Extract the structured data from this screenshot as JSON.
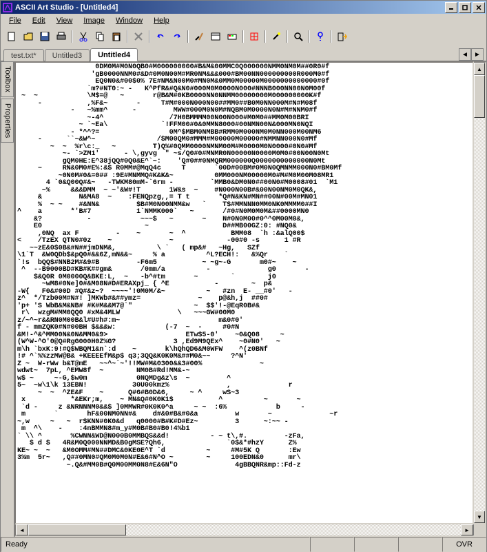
{
  "titlebar": {
    "text": "ASCII Art Studio - [Untitled4]"
  },
  "menu": {
    "file": "File",
    "edit": "Edit",
    "view": "View",
    "image": "Image",
    "window": "Window",
    "help": "Help"
  },
  "tabs": {
    "t1": "test.txt*",
    "t2": "Untitled3",
    "t3": "Untitled4"
  },
  "side": {
    "toolbox": "Toolbox",
    "properties": "Properties"
  },
  "status": {
    "ready": "Ready",
    "ovr": "OVR"
  },
  "ascii_art": "                   0DM0M#M0N0QB0#M000000000#B&M&00MMC0Q000000NMM0NM0M##0R0#f\n                  'gB0000NNM0#&D#0M0N00M#MR0NM&&&000#BM00NN000000000R000M0#f\n                   EQ0N0&#00$0% 7E#NM&N00M0#MN0M&0MM0M00000M0000000000000#0f\n                 `m?#NT0:~ -   K^PfR&#Q&N0#000M0M0000N000#NNNB000NN00N0M00f\n ~  ~            \\M$=@   ~       r@B&M#0KB0000NN0NNMM00000000M000000000K#f\n     -           ,%F&~       -     T#M#000N000N00##MM0##B0M0NN000M#N#M08f\n             -   ~%mm^      -         MWW#000M0N0M#NQBM0M0000N0N#M#NNM0#f\n                 ~-4^                /7H0BMMMM00N00N000#M0M0##MM0M00BRI\n               ~ `~Ea\\             `!FFM00#0&0MMN8000#00NMN00N&000MN0NQI\n             - *^^?=                 0M^$MBM0NMBB#RMM0M000NM0M0NN000M00NM6\n     -      ``~&W^~               /$M00QM0#MMM#M00000M00000#NMMNN000N0#Mf\n        ~  ~  %r\\c:_   ~         T)Q%#0QMM0000NMNM00M#M0000M0N0000#0N0#Mf\n           ~- `>ZM1'      - \\,gyvg  \" ~s/Q0#0#MNMR0N00000N0000M0M0#00N00N0Mt\n           gQM0HE:E^38jQQ#0Q0&E^`~:    'Q#0##0NMQRM000000Q0000000000000N0Mt\n     ~     RN&0M0#E%:&$ R0MM#@MqQ4c     T       `00D#00BM#0M0N0QMNMM000N0#BM0Mf\n          ~0N0M#0&=0## :9E#MNMMQ#K&K&~          0MM000NM00000M0#M#M0M00M08MR1\n       4 `0&Q00Q#&~   -TWKM80mM-`6rm -         `MMB0&DM0N0##00N0#M0008#01  `M1\n      ~%     &&&DMM  ~ ~'&W#!T       1W&s  ~    #N000N00B#&00N00NM0M0QK&,\n     &         N&MA8  ~    :FENQpzg,,= T t       *Q#N&KN#MN##00N#00M#MN01\n     %  ~ ~    #&NN&         $B#M0N00NMM&w   `    T$#MMNNN0MM0NK0MMMM0##I\n^    a       *'B#7           1`NMMK000`   ~       /#0#N0M0M0M&##0000MN0\n    &?           -            ~~~$   ~       ~    N#0N0M00#0^^0M00M0&,\n    E0                         ~                  D##MB00GZ:0: #NQ0&\n     ,0NQ  ax F         -    ~       ~  ^           BMM08  `h :&alQ00$\n<    /TzEX QTN0#0z    ~              ~             -00#0 -s      1 #R\n   ~~zE&0$0B&#N##jmDNM&,          \\ `   ( mp&#   ~Hg,   SZf\n\\1`T  &W0QDb$&pQ0#&&6Z,mN&&~     % a          ^L?ECH!:   &%Qr    `\n`!s  bQQ$#NNB2M#&9#B         -F6m5           ~ ~g~-G       m0#~    ~\n ^  --B9000BD#KB#K##gm&       /0mm/a          -              g0       -\n    $&Q0R 0M0000Q&BKE:L,  ~   -b^#tm       ~        `        j0\n      ~wM8#0Ne]0#&M08N#D#ERAXpj_ { ^E           -        ~  p&\n-W{   F0&#00D #Q#&z~?  ~~~~'!0M0M/&~          ~   #zn  E- __#0'   -\nz^  */Tzb00M#N#! ]MKWb#&##ymz=              ~    p@&h,j  ##0#\n'p+ 'S WbB&M&NB# #K#M&&M7@`\"               ~  $$'!-@EqR0B#&\n r\\  wzgM#MM0QQ0 #xM&4MLW              \\   ~~~GW#00M0\nz/~^~r&&RN0M00B&l#U#h#:m~                        m&0#0'\nf - mmZQK0#N#00BH $&&&w:            (-7  ~  -     #0#N\n&M!-^&^MM00N&0N&MM0&9>                   ETw$5-0'    ~0&Q08     ~\n(W^W-^O'0@Q#RgG000H0Z%G?              3 ,Ed9M9QEx^    ~0#N0'   ~\nm\\h `bxK:9!#Q$WBQM1&n`:d    ~       k\\hQhQD6&M0WFW    ^(z0BNf\n!# ^`%%zzMW@B& +KEEEEfM&p$ q3;3QQ&K0K0M&##M0&~~     ?^N'\nZ ~  W-rWw b&T@mE   ~~^~`~'!!MW#M&0300&&3#00%              ~\nwdwt~  7pL, ^EMW8f  ~        NM0B#Rd!MM&-~\nw$ ~     ~-G,$w0m            0NQMDg&z\\s  ~         ^\n5~  ~w\\1\\k 13EBN!           30U00kmz%              ,              r\n     ~  ~  ^ZE&F    ~      Q#6#B0D&6,     ~ ^     wS~3\n x           *&EKr;m,    ~ MN&Q#0K0K1$           ^          ~       ~\n `d -     z &NRNNNM0&&$ ]0MMWR#0K0K0^a     ~ ~  :6%            b     -\n m       `       hF&00NM0NN#&    d#&0#B&#0&a         w       ~              ~r\n~,w     ~   ~  r$KNN#0K0&d   q0000#B#K#D#Ez~         3      ~:~~ -\n m  ^\\    -    :4nBMMN8#m_y#M0B#B0#B0!4%b1\n` \\\\ ^       %CWNN&WD@N000B0MMBQS&&d!          - ~ t\\,#.         -zFa,\n   $ d $   4R&M0Q000NNMD&B0gMSE?Qh6,               `0$&*#hzY      Z%\nKE~ ~  ~   &M0OMM#MN##DMC&0KE0E^T `d          ~     #M#5K Q       :Ew\n3%m  5r~   ,Q##0MN0#QM0M0M0N#E&6#N^O ~        ~     100EDN&0      mr\\\n            ~.Q&#MM0B#Q0M00MM0N8#E&6N\"O              4gBBQNR&mp::Fd-z"
}
